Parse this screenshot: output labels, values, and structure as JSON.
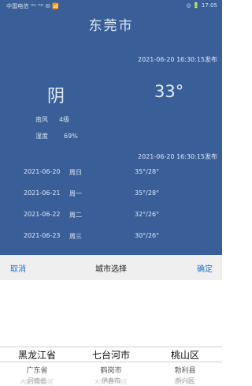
{
  "status_bar": {
    "left": "中国电信 ⁴ᴳ ᴴᴰ ✉ 📶",
    "right": "◎ 🔋 17:05"
  },
  "city": "东莞市",
  "publish_time_top": "2021-06-20 16:30:15发布",
  "current": {
    "condition": "阴",
    "temperature": "33°",
    "wind_label": "南风",
    "wind_value": "4级",
    "humidity_label": "湿度",
    "humidity_value": "69%"
  },
  "publish_time_forecast": "2021-06-20 16:30:15发布",
  "forecast": [
    {
      "date": "2021-06-20",
      "week": "周日",
      "temp": "35°/28°"
    },
    {
      "date": "2021-06-21",
      "week": "周一",
      "temp": "35°/28°"
    },
    {
      "date": "2021-06-22",
      "week": "周二",
      "temp": "32°/26°"
    },
    {
      "date": "2021-06-23",
      "week": "周三",
      "temp": "30°/26°"
    }
  ],
  "picker": {
    "cancel": "取消",
    "title": "城市选择",
    "confirm": "确定",
    "province": {
      "selected": "黑龙江省",
      "next": [
        "广东省",
        "河南省",
        "内蒙古自治区"
      ]
    },
    "city": {
      "selected": "七台河市",
      "next": [
        "鹤岗市",
        "伊春市",
        "大兴安岭地区"
      ]
    },
    "district": {
      "selected": "桃山区",
      "next": [
        "勃利县",
        "新兴区",
        "茄子河区"
      ]
    }
  },
  "colors": {
    "panel_bg": "#3a5f98",
    "accent_button": "#1b73d6"
  }
}
